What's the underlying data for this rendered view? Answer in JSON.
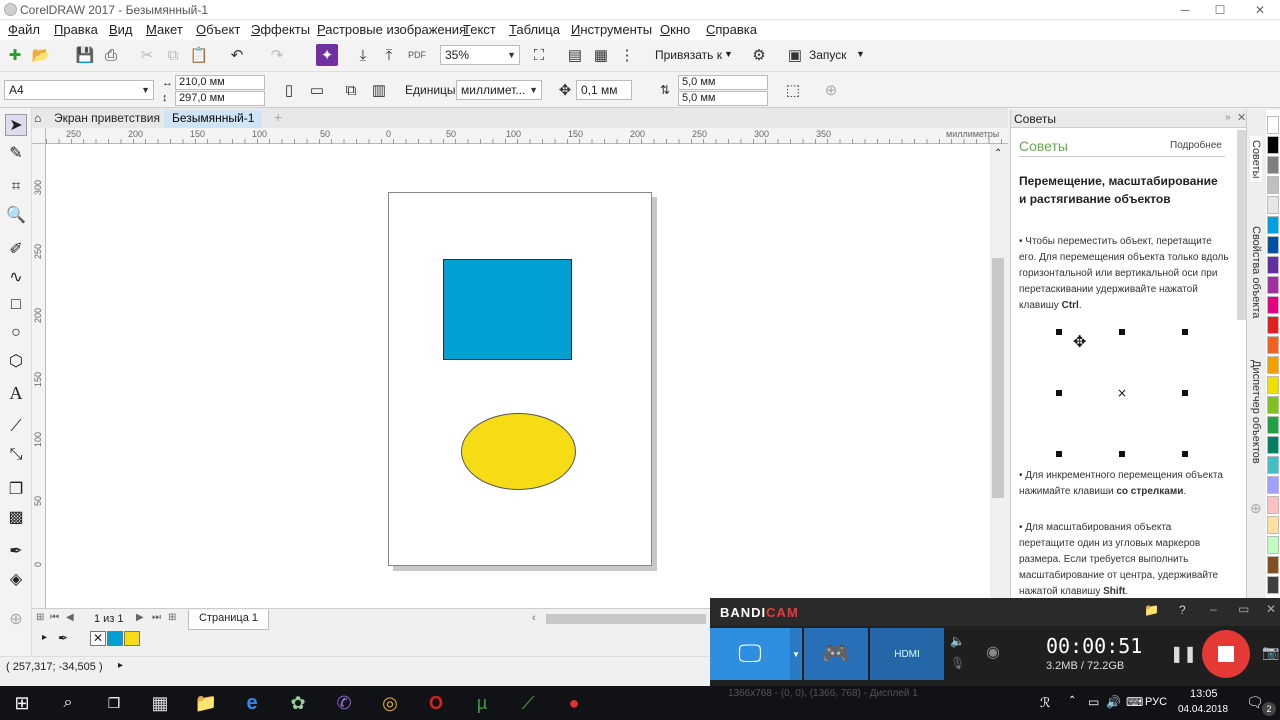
{
  "window": {
    "title": "CorelDRAW 2017 - Безымянный-1",
    "min": "─",
    "max": "☐",
    "close": "✕"
  },
  "menu": [
    "Файл",
    "Правка",
    "Вид",
    "Макет",
    "Объект",
    "Эффекты",
    "Растровые изображения",
    "Текст",
    "Таблица",
    "Инструменты",
    "Окно",
    "Справка"
  ],
  "toolbar": {
    "zoom": "35%",
    "snap_label": "Привязать к",
    "launch_label": "Запуск"
  },
  "propbar": {
    "paper": "A4",
    "width": "210,0 мм",
    "height": "297,0 мм",
    "units_label": "Единицы:",
    "units_value": "миллимет...",
    "nudge": "0,1 мм",
    "dup_x": "5,0 мм",
    "dup_y": "5,0 мм"
  },
  "doc_tabs": {
    "welcome": "Экран приветствия",
    "doc": "Безымянный-1"
  },
  "ruler": {
    "h_ticks": [
      "250",
      "200",
      "150",
      "100",
      "50",
      "0",
      "50",
      "100",
      "150",
      "200",
      "250",
      "300",
      "350"
    ],
    "units": "миллиметры",
    "v_ticks": [
      "300",
      "250",
      "200",
      "150",
      "100",
      "50",
      "0"
    ]
  },
  "shapes": {
    "rect_color": "#009fd4",
    "ellipse_color": "#f6dc14"
  },
  "pagenav": {
    "page_of": "1 из 1",
    "page_tab": "Страница 1"
  },
  "status": {
    "coords": "( 257,317; -34,505 )"
  },
  "docker": {
    "header": "Советы",
    "title": "Советы",
    "more": "Подробнее",
    "heading": "Перемещение, масштабирование и растягивание объектов",
    "tip1_a": "Чтобы переместить объект, перетащите его. Для перемещения объекта только вдоль горизонтальной или вертикальной оси при перетаскивании удерживайте нажатой клавишу ",
    "tip1_b": "Ctrl",
    "tip2_a": "Для инкрементного перемещения объекта нажимайте клавиши ",
    "tip2_b": "со стрелками",
    "tip3_a": "Для масштабирования объекта перетащите один из угловых маркеров размера. Если требуется выполнить масштабирование от центра, удерживайте нажатой клавишу ",
    "tip3_b": "Shift",
    "side_tabs": [
      "Советы",
      "Свойства объекта",
      "Диспетчер объектов"
    ]
  },
  "bandicam": {
    "brand_a": "BANDI",
    "brand_b": "CAM",
    "timer": "00:00:51",
    "size": "3.2MB / 72.2GB",
    "res": "1366x768 - (0, 0), (1366, 768) - Дисплей 1"
  },
  "taskbar": {
    "time": "13:05",
    "date": "04.04.2018",
    "lang": "РУС",
    "notif": "2"
  },
  "palette": [
    "#ffffff",
    "#000000",
    "#7f7f7f",
    "#c0c0c0",
    "#e6e6e6",
    "#00a0e0",
    "#0050a0",
    "#6030a0",
    "#a030a0",
    "#e00080",
    "#e02020",
    "#f06020",
    "#f0a000",
    "#f0e000",
    "#80c020",
    "#20a040",
    "#008060",
    "#40c0c0",
    "#a0a0ff",
    "#ffc0c0",
    "#ffe0a0",
    "#c0ffc0",
    "#805020",
    "#404040"
  ]
}
